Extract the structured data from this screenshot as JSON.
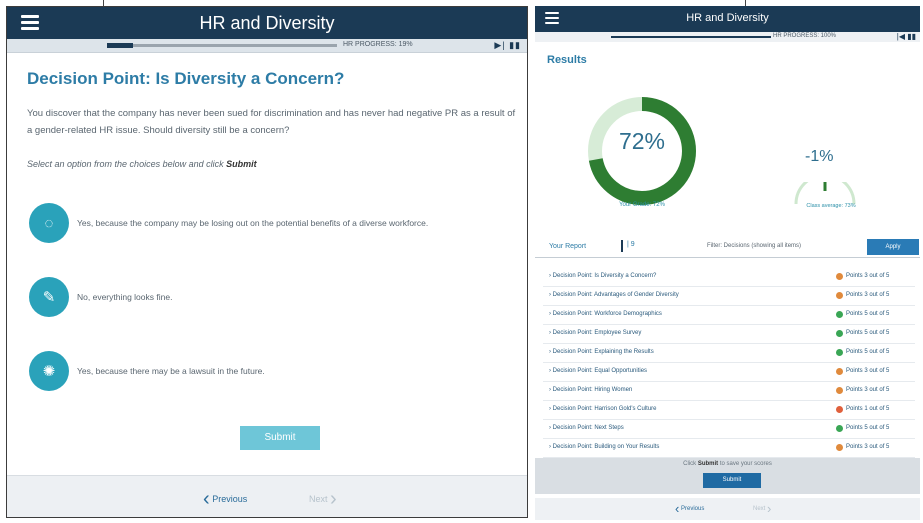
{
  "left": {
    "header": {
      "title": "HR and Diversity"
    },
    "progress": {
      "label": "HR PROGRESS: 19%",
      "controls": "▶| ▮▮"
    },
    "decision": {
      "title": "Decision Point: Is Diversity a Concern?",
      "text": "You discover that the company has never been sued for discrimination and has never had negative PR as a result of a gender-related HR issue. Should diversity still be a concern?",
      "instruction_prefix": "Select an option from the choices below and click ",
      "instruction_action": "Submit"
    },
    "options": [
      {
        "icon": "dots-circle-icon",
        "glyph": "◌",
        "label": "Yes, because the company may be losing out on the potential benefits of a diverse workforce."
      },
      {
        "icon": "edit-icon",
        "glyph": "✎",
        "label": "No, everything looks fine."
      },
      {
        "icon": "handshake-icon",
        "glyph": "✺",
        "label": "Yes, because there may be a lawsuit in the future."
      }
    ],
    "submit_label": "Submit",
    "footer": {
      "prev_label": "Previous",
      "next_label": "Next"
    }
  },
  "right": {
    "header": {
      "title": "HR and Diversity"
    },
    "progress": {
      "label": "HR PROGRESS: 100%",
      "controls": "|◀ ▮▮"
    },
    "results_title": "Results",
    "score": {
      "value": 72,
      "display": "72%",
      "label": "Your Grade: 72%"
    },
    "comparison": {
      "display": "-1%",
      "label": "Class average: 73%"
    },
    "tabs": {
      "report": "Your Report",
      "selected": "| 9"
    },
    "filter_label": "Filter: Decisions (showing all items)",
    "apply_label": "Apply",
    "report": [
      {
        "label": "› Decision Point: Is Diversity a Concern?",
        "points": "Points 3 out of 5",
        "color": "#e08a3c"
      },
      {
        "label": "› Decision Point: Advantages of Gender Diversity",
        "points": "Points 3 out of 5",
        "color": "#e08a3c"
      },
      {
        "label": "› Decision Point: Workforce Demographics",
        "points": "Points 5 out of 5",
        "color": "#3aa655"
      },
      {
        "label": "› Decision Point: Employee Survey",
        "points": "Points 5 out of 5",
        "color": "#3aa655"
      },
      {
        "label": "› Decision Point: Explaining the Results",
        "points": "Points 5 out of 5",
        "color": "#3aa655"
      },
      {
        "label": "› Decision Point: Equal Opportunities",
        "points": "Points 3 out of 5",
        "color": "#e08a3c"
      },
      {
        "label": "› Decision Point: Hiring Women",
        "points": "Points 3 out of 5",
        "color": "#e08a3c"
      },
      {
        "label": "› Decision Point: Harrison Gold's Culture",
        "points": "Points 1 out of 5",
        "color": "#e0603c"
      },
      {
        "label": "› Decision Point: Next Steps",
        "points": "Points 5 out of 5",
        "color": "#3aa655"
      },
      {
        "label": "› Decision Point: Building on Your Results",
        "points": "Points 3 out of 5",
        "color": "#e08a3c"
      }
    ],
    "submit_note_prefix": "Click ",
    "submit_note_action": "Submit",
    "submit_note_suffix": " to save your scores",
    "submit_label": "Submit",
    "footer": {
      "prev_label": "Previous",
      "next_label": "Next"
    }
  },
  "colors": {
    "header": "#1b3a55",
    "accent": "#2aa2ba",
    "donut": "#2e7d32",
    "donut_track": "#d7ecd7"
  }
}
